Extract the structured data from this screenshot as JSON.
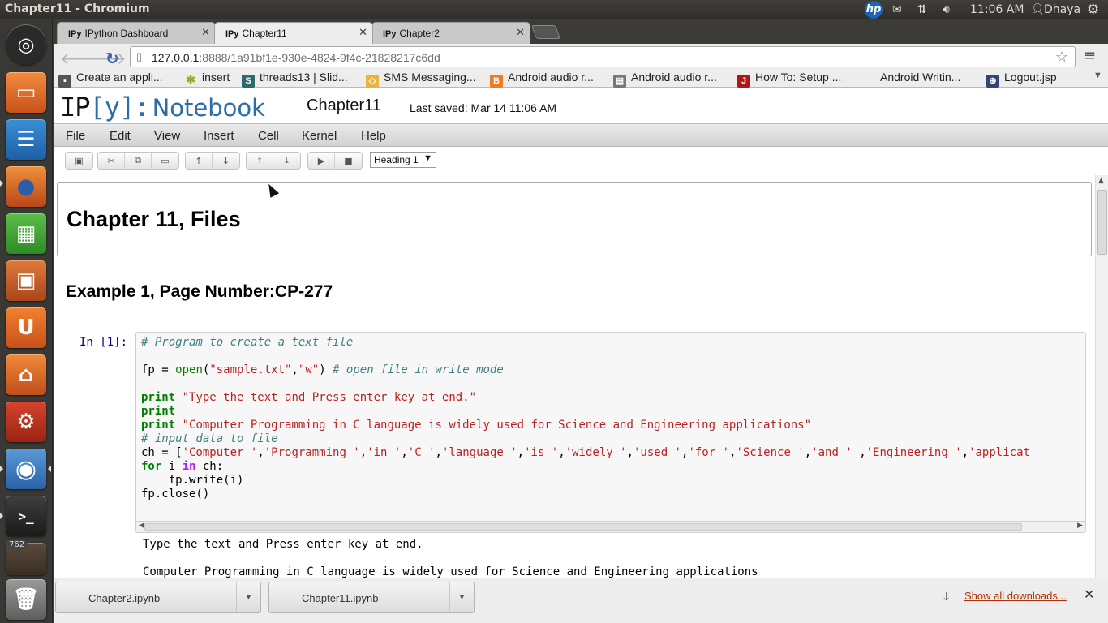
{
  "window": {
    "title": "Chapter11 - Chromium"
  },
  "panel": {
    "hp_label": "hp",
    "time": "11:06 AM",
    "user": "Dhaya"
  },
  "launcher": {
    "badge_count": "762",
    "items": [
      "ubuntu-dash",
      "files",
      "writer",
      "firefox",
      "calc",
      "impress",
      "ubuntu-one",
      "software-center",
      "system-settings",
      "chromium",
      "terminal",
      "workspace-switcher",
      "trash"
    ]
  },
  "tabs": [
    {
      "favicon": "IPy",
      "label": "IPython Dashboard"
    },
    {
      "favicon": "IPy",
      "label": "Chapter11"
    },
    {
      "favicon": "IPy",
      "label": "Chapter2"
    }
  ],
  "url": {
    "host": "127.0.0.1",
    "rest": ":8888/1a91bf1e-930e-4824-9f4c-21828217c6dd"
  },
  "bookmarks": [
    {
      "label": "Create an appli...",
      "icon": "image",
      "color": "#555555"
    },
    {
      "label": "insert",
      "icon": "android",
      "color": "#8fb31b"
    },
    {
      "label": "threads13 | Slid...",
      "icon": "slideshare",
      "color": "#2c6b6b"
    },
    {
      "label": "SMS Messaging...",
      "icon": "sms",
      "color": "#e8b53a"
    },
    {
      "label": "Android audio r...",
      "icon": "blogger",
      "color": "#f07a1c"
    },
    {
      "label": "Android audio r...",
      "icon": "page",
      "color": "#777777"
    },
    {
      "label": "How To: Setup ...",
      "icon": "jv",
      "color": "#b01616"
    },
    {
      "label": "Android Writin...",
      "icon": "none",
      "color": "#ededed"
    },
    {
      "label": "Logout.jsp",
      "icon": "jsp",
      "color": "#334477"
    }
  ],
  "notebook": {
    "logo_ip": "IP",
    "logo_y": "[y]:",
    "logo_notebook": "Notebook",
    "name": "Chapter11",
    "last_saved": "Last saved: Mar 14 11:06 AM",
    "menus": [
      "File",
      "Edit",
      "View",
      "Insert",
      "Cell",
      "Kernel",
      "Help"
    ],
    "cell_type": "Heading 1",
    "heading1": "Chapter 11, Files",
    "heading2": "Example 1, Page Number:CP-277",
    "prompt": "In [1]:",
    "code_lines": [
      "# Program to create a text file",
      "",
      "fp = open(\"sample.txt\",\"w\") # open file in write mode",
      "",
      "print \"Type the text and Press enter key at end.\"",
      "print",
      "print \"Computer Programming in C language is widely used for Science and Engineering applications\"",
      "# input data to file",
      "ch = ['Computer ','Programming ','in ','C ','language ','is ','widely ','used ','for ','Science ','and ' ,'Engineering ','applicat",
      "for i in ch:",
      "    fp.write(i)",
      "fp.close()"
    ],
    "output_lines": [
      "Type the text and Press enter key at end.",
      "",
      "Computer Programming in C language is widely used for Science and Engineering applications"
    ]
  },
  "downloads": {
    "items": [
      "Chapter2.ipynb",
      "Chapter11.ipynb"
    ],
    "show_all": "Show all downloads..."
  }
}
